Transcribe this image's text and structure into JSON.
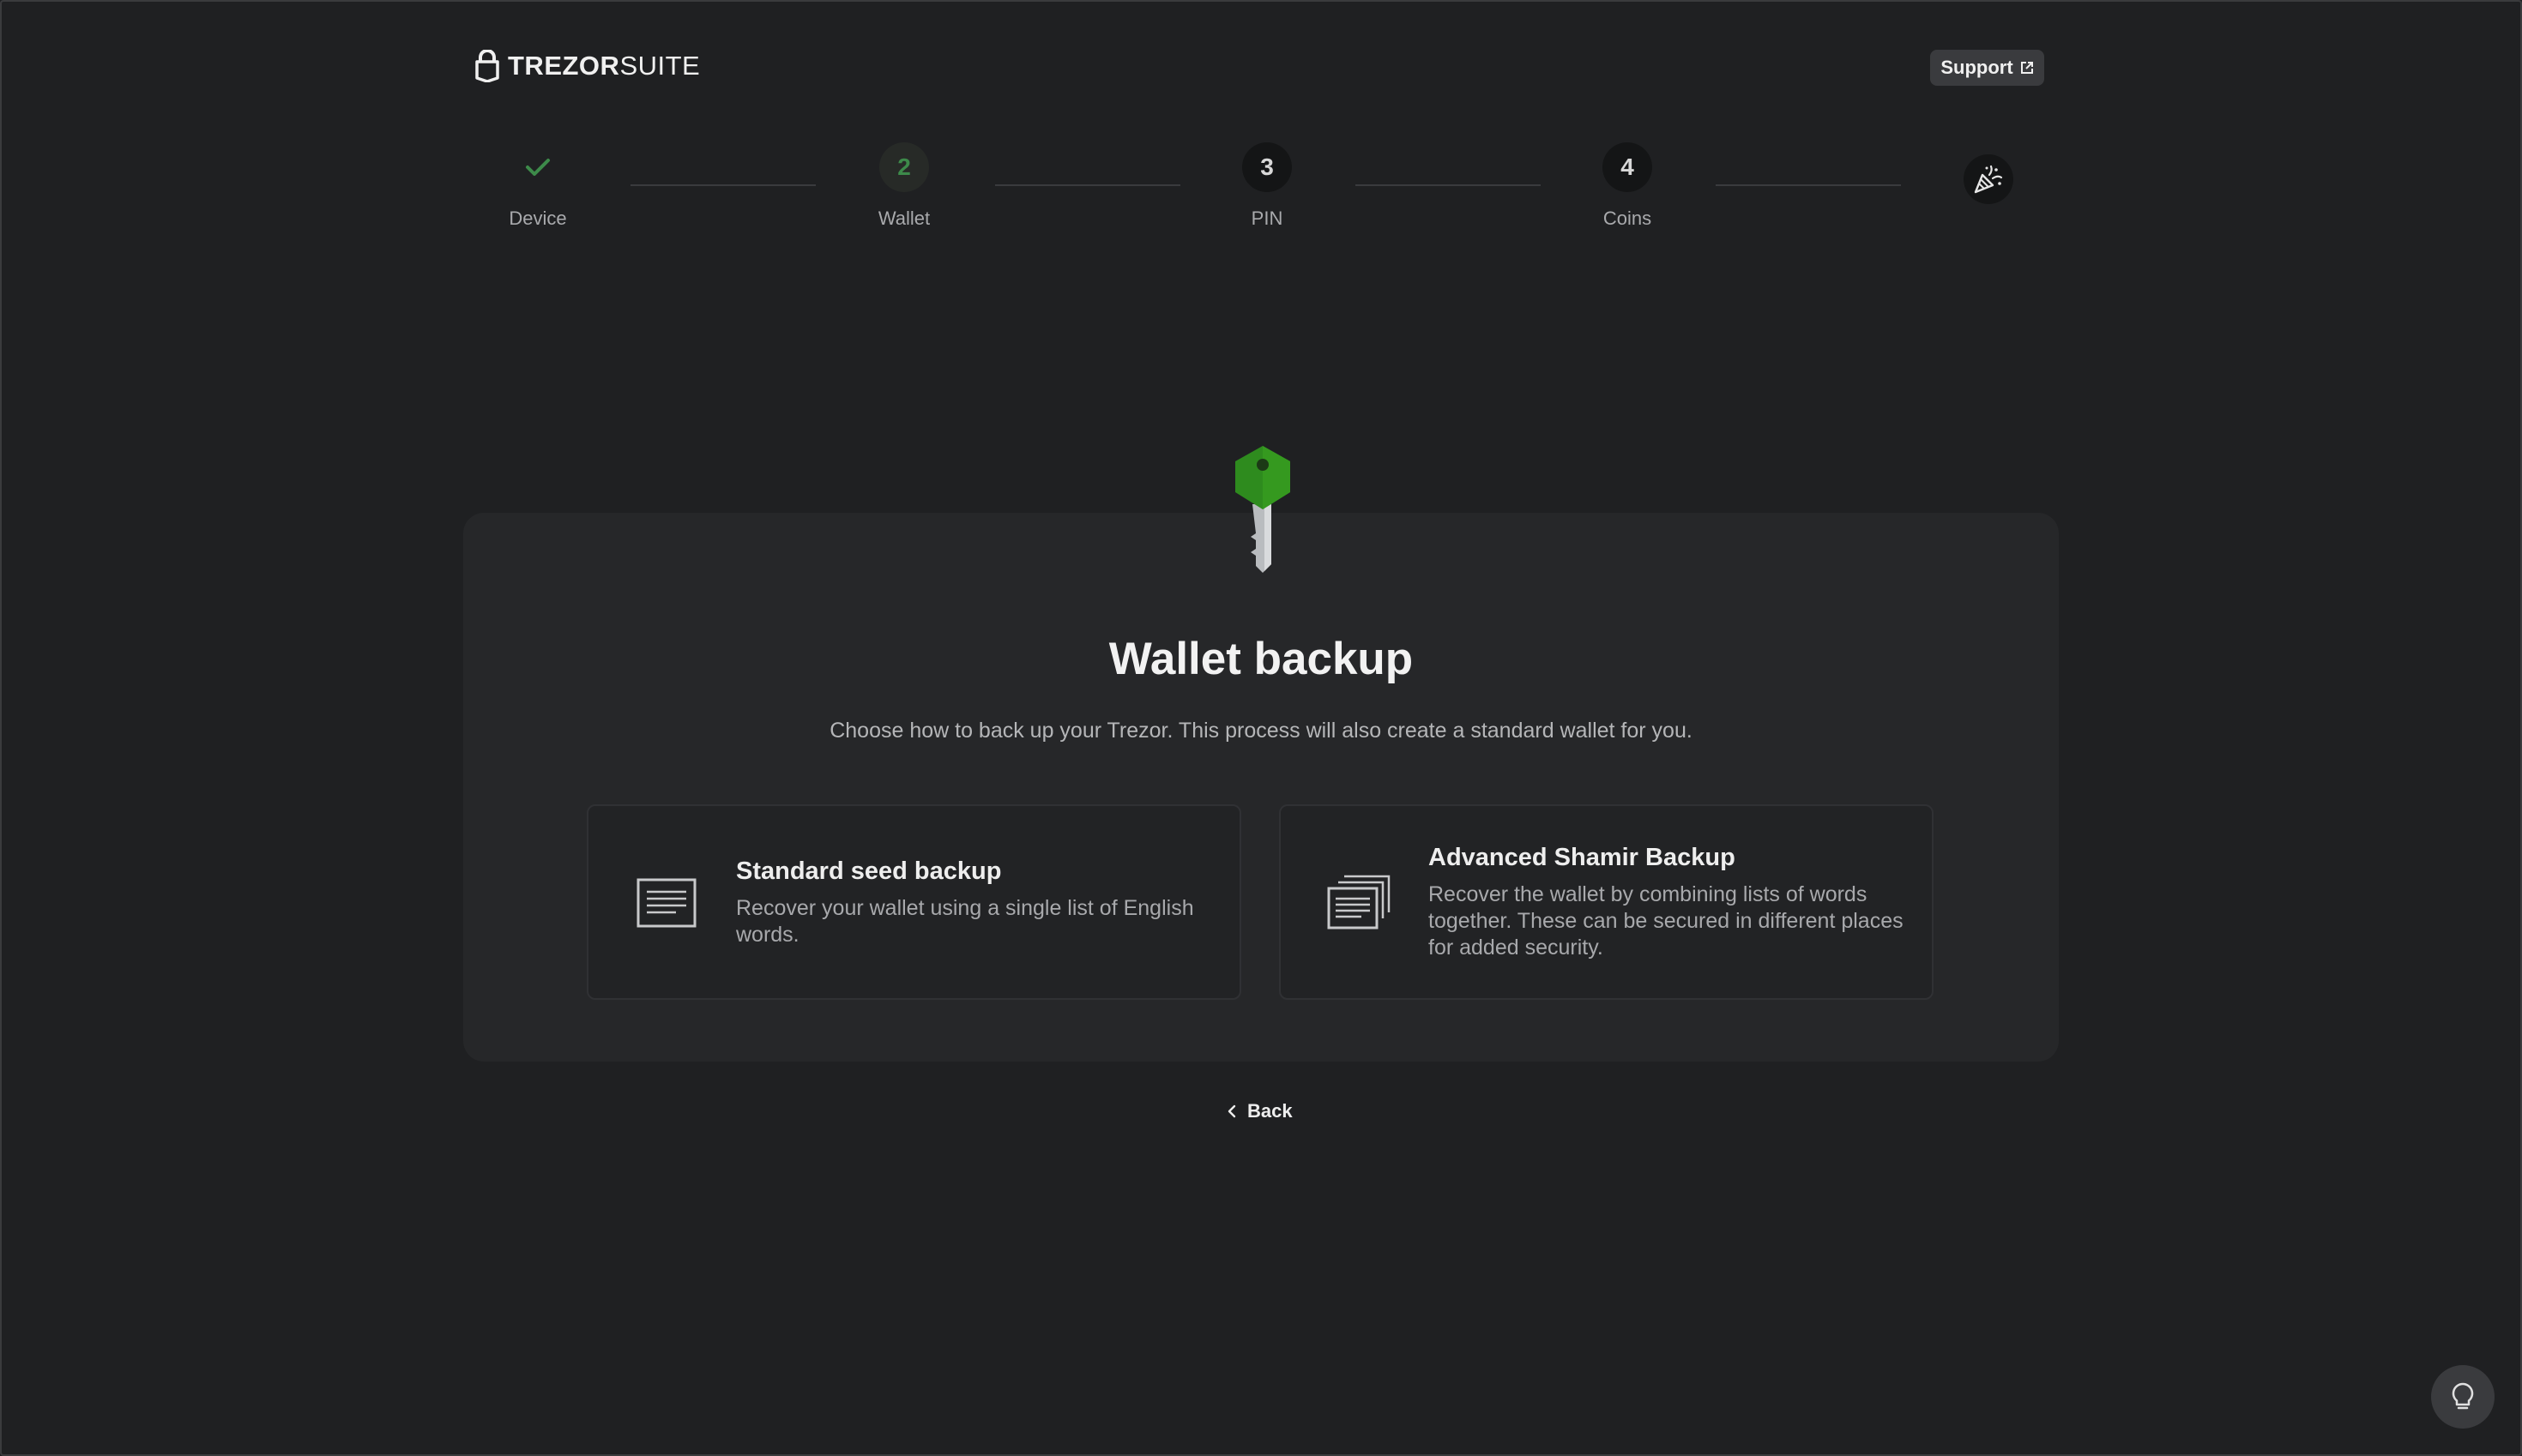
{
  "header": {
    "logo_bold": "TREZOR",
    "logo_light": "SUITE",
    "logo_icon": "lock-icon",
    "support_label": "Support",
    "support_icon": "external-link-icon"
  },
  "stepper": {
    "steps": [
      {
        "number": "",
        "label": "Device",
        "state": "done",
        "icon": "check-icon"
      },
      {
        "number": "2",
        "label": "Wallet",
        "state": "active"
      },
      {
        "number": "3",
        "label": "PIN",
        "state": "todo"
      },
      {
        "number": "4",
        "label": "Coins",
        "state": "todo"
      }
    ],
    "final_icon": "party-popper-icon"
  },
  "main": {
    "illustration": "key-icon",
    "title": "Wallet backup",
    "subtitle": "Choose how to back up your Trezor. This process will also create a standard wallet for you.",
    "options": [
      {
        "icon": "single-document-icon",
        "title": "Standard seed backup",
        "description": "Recover your wallet using a single list of English words."
      },
      {
        "icon": "stacked-documents-icon",
        "title": "Advanced Shamir Backup",
        "description": "Recover the wallet by combining lists of words together. These can be secured in different places for added security."
      }
    ],
    "back_label": "Back"
  },
  "help_icon": "lightbulb-icon",
  "colors": {
    "background": "#1f2022",
    "card": "#262729",
    "accent_green": "#3d8a4a",
    "key_green": "#2e8b1e"
  }
}
